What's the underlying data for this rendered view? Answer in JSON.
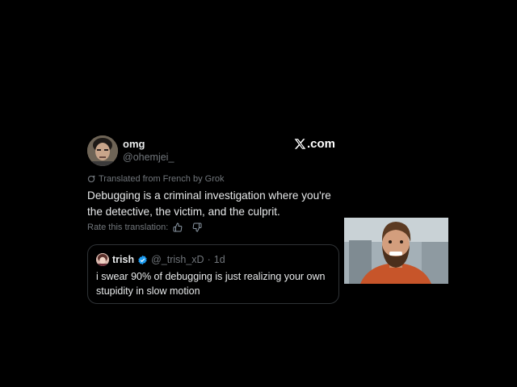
{
  "post": {
    "display_name": "omg",
    "handle": "@ohemjei_",
    "brand": ".com",
    "translated_label": "Translated from French by Grok",
    "text": "Debugging is a criminal investigation where you're the detective, the victim, and the culprit.",
    "rate_label": "Rate this translation:",
    "avatar_icon": "user-avatar-photo"
  },
  "quote": {
    "display_name": "trish",
    "handle": "@_trish_xD",
    "separator": "·",
    "time": "1d",
    "text": "i swear 90% of debugging is just realizing your own stupidity in slow motion",
    "verified_icon": "verified-badge-icon",
    "verified_color": "#1d9bf0"
  },
  "colors": {
    "background": "#000000",
    "text_primary": "#e7e9ea",
    "text_secondary": "#71767b",
    "border": "#2f3336"
  }
}
